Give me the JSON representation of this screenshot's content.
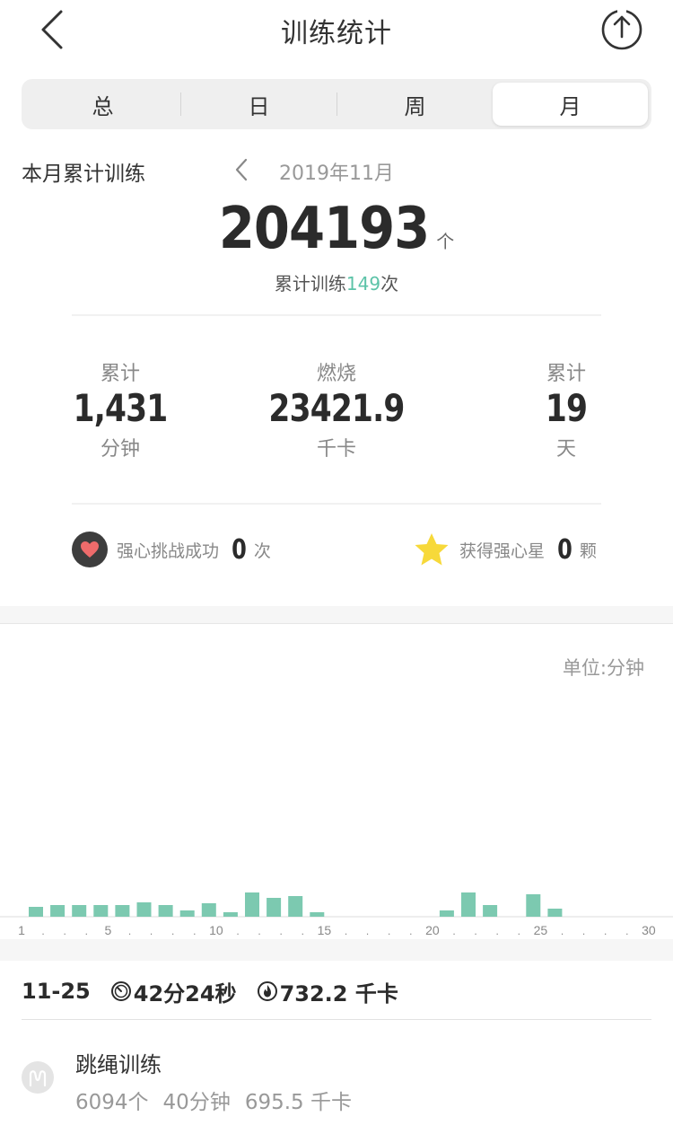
{
  "navbar": {
    "title": "训练统计",
    "back_icon": "chevron-left-icon",
    "share_icon": "share-upload-icon"
  },
  "tabs": [
    {
      "label": "总",
      "active": false
    },
    {
      "label": "日",
      "active": false
    },
    {
      "label": "周",
      "active": false
    },
    {
      "label": "月",
      "active": true
    }
  ],
  "summary": {
    "label": "本月累计训练",
    "date": "2019年11月",
    "total": "204193",
    "total_unit": "个",
    "sessions_prefix": "累计训练",
    "sessions_count": "149",
    "sessions_suffix": "次"
  },
  "stats": [
    {
      "top": "累计",
      "value": "1,431",
      "bottom": "分钟"
    },
    {
      "top": "燃烧",
      "value": "23421.9",
      "bottom": "千卡"
    },
    {
      "top": "累计",
      "value": "19",
      "bottom": "天"
    }
  ],
  "badges": {
    "heart": {
      "label": "强心挑战成功",
      "value": "0",
      "unit": "次"
    },
    "star": {
      "label": "获得强心星",
      "value": "0",
      "unit": "颗"
    }
  },
  "chart_unit": "单位:分钟",
  "colors": {
    "accent": "#5cc3a8",
    "bar": "#7cc9b0",
    "star": "#f7d93a",
    "heart": "#ee6b6b"
  },
  "chart_data": {
    "type": "bar",
    "x": [
      1,
      2,
      3,
      4,
      5,
      6,
      7,
      8,
      9,
      10,
      11,
      12,
      13,
      14,
      15,
      16,
      17,
      18,
      19,
      20,
      21,
      22,
      23,
      24,
      25,
      26,
      27,
      28,
      29,
      30
    ],
    "values": [
      11,
      13,
      13,
      13,
      13,
      16,
      13,
      7,
      15,
      5,
      27,
      21,
      23,
      5,
      0,
      0,
      0,
      0,
      0,
      7,
      27,
      13,
      0,
      25,
      9,
      0,
      0,
      0,
      0,
      0
    ],
    "tick_labels": [
      "1",
      "5",
      "10",
      "15",
      "20",
      "25",
      "30"
    ],
    "ylabel": "单位:分钟"
  },
  "day_detail": {
    "date": "11-25",
    "duration": "42分24秒",
    "calories": "732.2 千卡"
  },
  "record": {
    "title": "跳绳训练",
    "count": "6094个",
    "minutes": "40分钟",
    "calories": "695.5 千卡"
  }
}
